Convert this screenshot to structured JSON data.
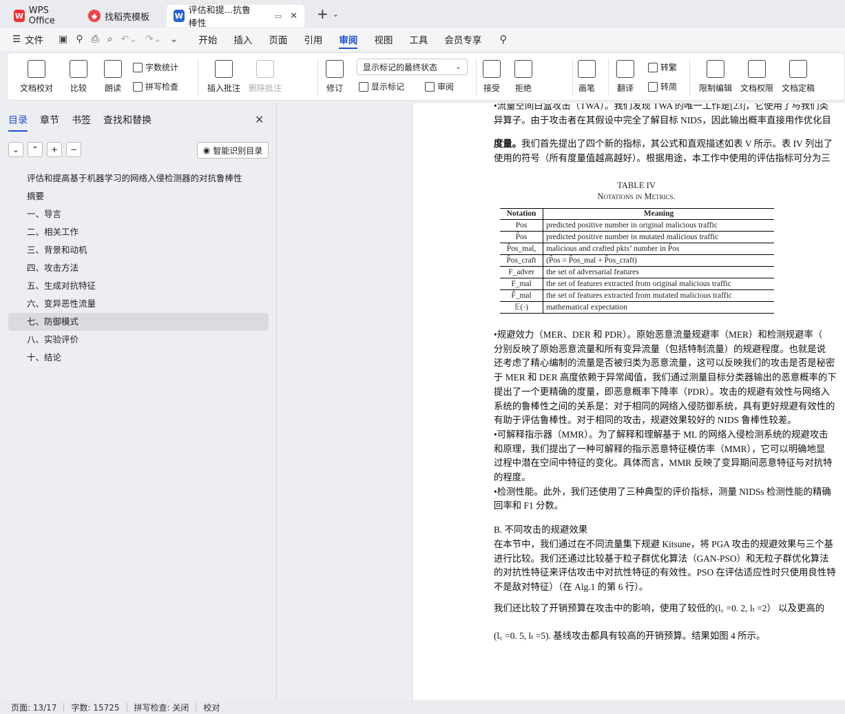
{
  "tabs": [
    {
      "label": "WPS Office"
    },
    {
      "label": "找稻壳模板"
    },
    {
      "label": "评估和提...抗鲁棒性"
    }
  ],
  "menu": {
    "file": "文件",
    "items": [
      "开始",
      "插入",
      "页面",
      "引用",
      "审阅",
      "视图",
      "工具",
      "会员专享"
    ],
    "active": "审阅"
  },
  "ribbon": {
    "doc_check": "文档校对",
    "compare": "比较",
    "read_aloud": "朗读",
    "word_count": "字数统计",
    "spell_check": "拼写检查",
    "insert_comment": "插入批注",
    "delete_comment": "删除批注",
    "revise": "修订",
    "markup_state": "显示标记的最终状态",
    "show_markup": "显示标记",
    "review_pane": "审阅",
    "accept": "接受",
    "reject": "拒绝",
    "pen": "画笔",
    "translate": "翻译",
    "to_simplified": "转繁",
    "to_traditional": "转简",
    "restrict_edit": "限制编辑",
    "doc_permission": "文档权限",
    "doc_finalize": "文档定稿"
  },
  "panel": {
    "tabs": [
      "目录",
      "章节",
      "书签",
      "查找和替换"
    ],
    "smart_toc": "智能识别目录",
    "toc": [
      "评估和提高基于机器学习的网络入侵检测器的对抗鲁棒性",
      "摘要",
      "一、导言",
      "二、相关工作",
      "三、背景和动机",
      "四、攻击方法",
      "五、生成对抗特征",
      "六、变异恶性流量",
      "七、防御模式",
      "八、实验评价",
      "十、结论"
    ],
    "selected_index": 8
  },
  "document": {
    "lines_top": [
      "•流量空间白盒攻击（TWA）。我们发现 TWA 的唯一工作是[23]，它使用了与我们类",
      "异算子。由于攻击者在其假设中完全了解目标 NIDS，因此输出概率直接用作优化目"
    ],
    "metric_bold": "度量。",
    "metric_rest": "我们首先提出了四个新的指标，其公式和直观描述如表 V 所示。表 IV 列出了",
    "metric_line2": "使用的符号（所有度量值越高越好）。根据用途，本工作中使用的评估指标可分为三",
    "table_title": "TABLE IV",
    "table_subtitle": "Notations in Metrics.",
    "table_head": [
      "Notation",
      "Meaning"
    ],
    "table_rows": [
      [
        "Pos",
        "predicted positive number in original malicious traffic"
      ],
      [
        "P̂os",
        "predicted positive number in mutated malicious traffic"
      ],
      [
        "P̂os_mal,",
        "malicious and crafted pkts’ number in P̂os"
      ],
      [
        "P̂os_craft",
        "(P̂os = P̂os_mal + P̂os_craft)"
      ],
      [
        "F_adver",
        "the set of adversarial features"
      ],
      [
        "F_mal",
        "the set of features extracted from original malicious traffic"
      ],
      [
        "F̂_mal",
        "the set of features extracted from mutated malicious traffic"
      ],
      [
        "𝔼(·)",
        "mathematical expectation"
      ]
    ],
    "lines_mid": [
      "•规避效力（MER、DER 和 PDR）。原始恶意流量规避率（MER）和检测规避率（",
      "分别反映了原始恶意流量和所有变异流量（包括特制流量）的规避程度。也就是说",
      "还考虑了精心编制的流量是否被归类为恶意流量，这可以反映我们的攻击是否是秘密",
      "于 MER 和 DER 高度依赖于异常阈值，我们通过测量目标分类器输出的恶意概率的下",
      "提出了一个更精确的度量，即恶意概率下降率（PDR）。攻击的规避有效性与网络入",
      "系统的鲁棒性之间的关系是：对于相同的网络入侵防御系统，具有更好规避有效性的",
      "有助于评估鲁棒性。对于相同的攻击，规避效果较好的 NIDS 鲁棒性较差。",
      "•可解释指示器（MMR）。为了解释和理解基于 ML 的网络入侵检测系统的规避攻击",
      "和原理，我们提出了一种可解释的指示恶意特征模仿率（MMR），它可以明确地显",
      "过程中潜在空间中特征的变化。具体而言，MMR 反映了变异期间恶意特征与对抗特",
      "的程度。",
      "•检测性能。此外，我们还使用了三种典型的评价指标，测量 NIDSs 检测性能的精确",
      "回率和 F1 分数。"
    ],
    "section_b": "B.  不同攻击的规避效果",
    "lines_b": [
      "在本节中，我们通过在不同流量集下规避 Kitsune，将 PGA 攻击的规避效果与三个基",
      "进行比较。我们还通过比较基于粒子群优化算法（GAN-PSO）和无粒子群优化算法",
      "的对抗性特征来评估攻击中对抗性特征的有效性。PSO 在评估适应性时只使用良性特",
      "不是敌对特征）（在 Alg.1 的第 6 行）。"
    ],
    "line_cost": "我们还比较了开销预算在攻击中的影响，使用了较低的(l꜀ =0. 2,  lₜ =2）  以及更高的",
    "line_cost2": "(l꜀ =0. 5,  lₜ =5). 基线攻击都具有较高的开销预算。结果如图 4 所示。"
  },
  "status": {
    "page": "页面: 13/17",
    "words": "字数: 15725",
    "spell": "拼写检查: 关闭",
    "proof": "校对"
  }
}
